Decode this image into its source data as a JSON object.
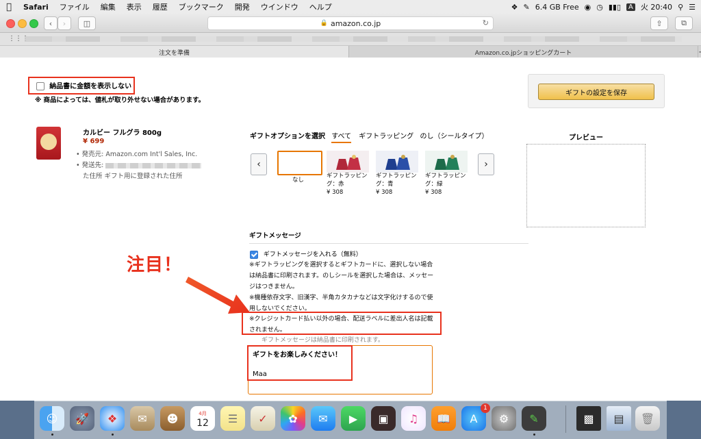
{
  "menubar": {
    "app": "Safari",
    "items": [
      "ファイル",
      "編集",
      "表示",
      "履歴",
      "ブックマーク",
      "開発",
      "ウインドウ",
      "ヘルプ"
    ],
    "memory": "6.4 GB Free",
    "input_mode": "A",
    "clock": "火 20:40"
  },
  "browser": {
    "url": "amazon.co.jp",
    "tabs": [
      "注文を準備",
      "Amazon.co.jpショッピングカート"
    ]
  },
  "page": {
    "hide_amount_label": "納品書に金額を表示しない",
    "hide_amount_note": "※ 商品によっては、値札が取り外せない場合があります。",
    "save_button": "ギフトの設定を保存",
    "product": {
      "name": "カルビー フルグラ 800g",
      "price": "¥ 699",
      "seller": "発売元: Amazon.com Int'l Sales, Inc.",
      "ship_to_prefix": "発送先:",
      "ship_to_suffix": "た住所 ギフト用に登録された住所"
    },
    "gift_options": {
      "title": "ギフトオプションを選択",
      "tabs": [
        "すべて",
        "ギフトラッピング",
        "のし（シールタイプ）"
      ],
      "items": [
        {
          "caption": "なし",
          "price": ""
        },
        {
          "caption": "ギフトラッピング：赤",
          "price": "¥ 308",
          "color": "#b0283a"
        },
        {
          "caption": "ギフトラッピング：青",
          "price": "¥ 308",
          "color": "#1f3f8f"
        },
        {
          "caption": "ギフトラッピング：緑",
          "price": "¥ 308",
          "color": "#1d6b4a"
        }
      ]
    },
    "preview_title": "プレビュー",
    "message": {
      "title": "ギフトメッセージ",
      "checkbox_label": "ギフトメッセージを入れる（無料）",
      "note1": "※ギフトラッピングを選択するとギフトカードに、選択しない場合は納品書に印刷されます。のしシールを選択した場合は、メッセージはつきません。",
      "note2": "※機種依存文字、旧漢字、半角カタカナなどは文字化けするので使用しないでください。",
      "note3": "※クレジットカード払い以外の場合、配送ラベルに差出人名は記載されません。",
      "print_note": "ギフトメッセージは納品書に印刷されます。",
      "text_line1": "ギフトをお楽しみください！",
      "text_line2": "Maa"
    },
    "annotation": "注目！"
  },
  "dock": {
    "calendar_month": "4月",
    "calendar_day": "12",
    "appstore_badge": "1"
  },
  "colors": {
    "accent_red": "#e8311d",
    "price": "#b12704",
    "amazon_button": "#f0c14b"
  }
}
